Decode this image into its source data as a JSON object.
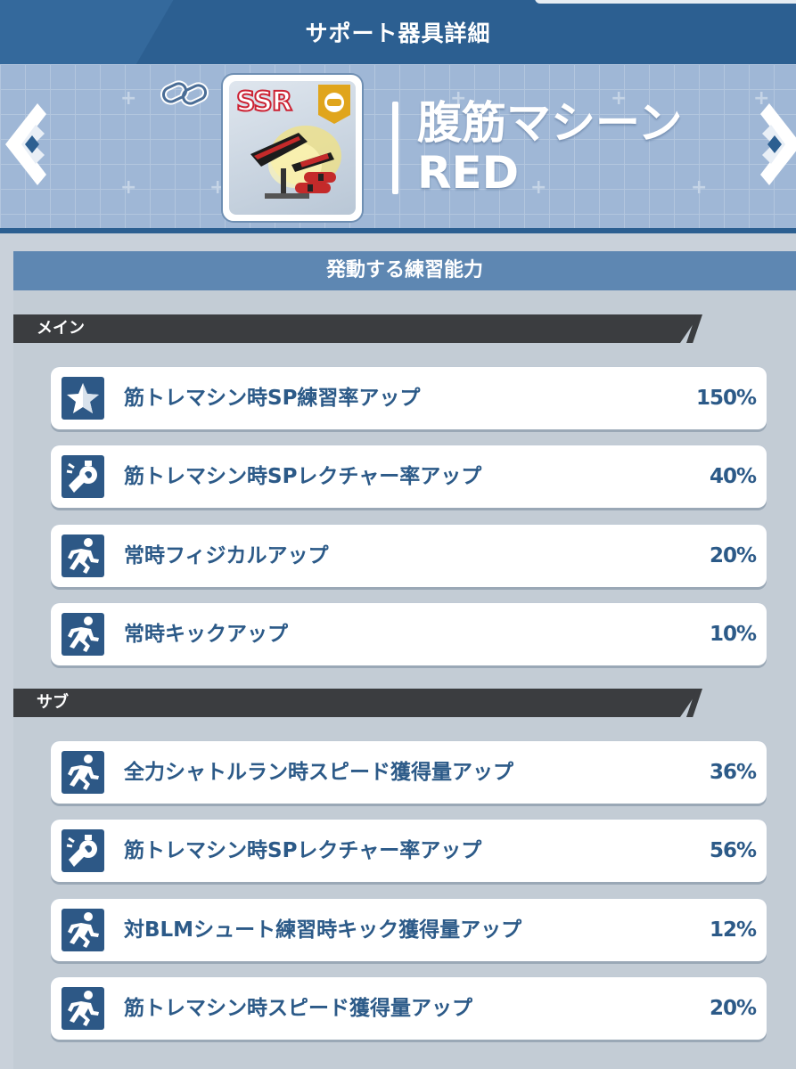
{
  "header": {
    "title": "サポート器具詳細"
  },
  "item": {
    "rarity": "SSR",
    "name_line1": "腹筋マシーン",
    "name_line2": "RED"
  },
  "section": {
    "title": "発動する練習能力"
  },
  "groups": {
    "main": {
      "label": "メイン",
      "rows": [
        {
          "icon": "star-icon",
          "label": "筋トレマシン時SP練習率アップ",
          "value": "150%"
        },
        {
          "icon": "whistle-icon",
          "label": "筋トレマシン時SPレクチャー率アップ",
          "value": "40%"
        },
        {
          "icon": "running-icon",
          "label": "常時フィジカルアップ",
          "value": "20%"
        },
        {
          "icon": "running-icon",
          "label": "常時キックアップ",
          "value": "10%"
        }
      ]
    },
    "sub": {
      "label": "サブ",
      "rows": [
        {
          "icon": "running-icon",
          "label": "全力シャトルラン時スピード獲得量アップ",
          "value": "36%"
        },
        {
          "icon": "whistle-icon",
          "label": "筋トレマシン時SPレクチャー率アップ",
          "value": "56%"
        },
        {
          "icon": "running-icon",
          "label": "対BLMシュート練習時キック獲得量アップ",
          "value": "12%"
        },
        {
          "icon": "running-icon",
          "label": "筋トレマシン時スピード獲得量アップ",
          "value": "20%"
        }
      ]
    }
  },
  "colors": {
    "header_blue": "#2c5f91",
    "section_blue": "#5e87b2",
    "text_blue": "#2c5a88",
    "group_dark": "#3b3d40",
    "badge_gold": "#e0a51c"
  }
}
